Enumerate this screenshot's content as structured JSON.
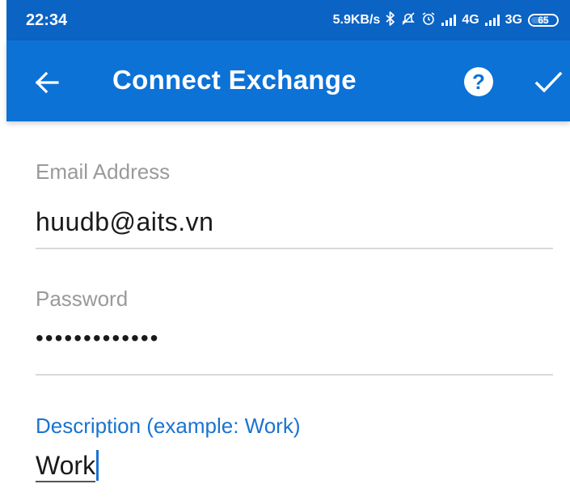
{
  "status_bar": {
    "time": "22:34",
    "network_speed": "5.9KB/s",
    "network_4g": "4G",
    "network_3g": "3G",
    "battery": "65",
    "icons": [
      "bluetooth-icon",
      "alarm-off-icon",
      "alarm-clock-icon",
      "signal-icon",
      "signal-icon"
    ]
  },
  "app_bar": {
    "title": "Connect Exchange",
    "back_icon": "arrow-back-icon",
    "help_label": "?",
    "confirm_icon": "check-icon"
  },
  "form": {
    "email": {
      "label": "Email Address",
      "value": "huudb@aits.vn"
    },
    "password": {
      "label": "Password",
      "value": "•••••••••••••"
    },
    "description": {
      "label": "Description (example: Work)",
      "value": "Work"
    }
  },
  "colors": {
    "status_bar": "#0b63c4",
    "app_bar": "#0c72d6",
    "active_label": "#1a73d1",
    "inactive_label": "#9a9a9a"
  }
}
